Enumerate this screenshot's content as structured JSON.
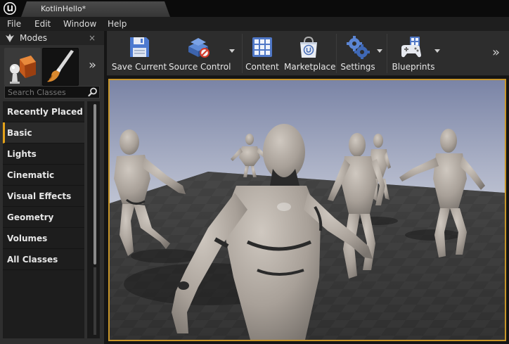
{
  "window": {
    "tab_title": "KotlinHello*",
    "logo_icon": "unreal-engine-logo-icon"
  },
  "menu": {
    "items": [
      "File",
      "Edit",
      "Window",
      "Help"
    ]
  },
  "modes": {
    "title": "Modes",
    "close_glyph": "×",
    "expand_glyph": "»",
    "tiles": [
      {
        "name": "place-mode",
        "icon": "place-actor-icon"
      },
      {
        "name": "paint-mode",
        "icon": "paint-brush-icon"
      }
    ],
    "search": {
      "placeholder": "Search Classes",
      "value": ""
    },
    "categories": [
      "Recently Placed",
      "Basic",
      "Lights",
      "Cinematic",
      "Visual Effects",
      "Geometry",
      "Volumes",
      "All Classes"
    ],
    "selected_category": "Basic"
  },
  "toolbar": {
    "expand_glyph": "»",
    "buttons": [
      {
        "label": "Save Current",
        "icon": "floppy-disk-icon",
        "dropdown": false
      },
      {
        "label": "Source Control",
        "icon": "source-control-icon",
        "dropdown": true
      },
      {
        "label": "Content",
        "icon": "content-browser-icon",
        "dropdown": false
      },
      {
        "label": "Marketplace",
        "icon": "marketplace-bag-icon",
        "dropdown": false
      },
      {
        "label": "Settings",
        "icon": "settings-gears-icon",
        "dropdown": true
      },
      {
        "label": "Blueprints",
        "icon": "gamepad-blueprint-icon",
        "dropdown": true
      }
    ]
  },
  "colors": {
    "accent": "#e3a21a",
    "viewport_border": "#c8962a",
    "panel": "#2f2f2f",
    "toolbar": "#2d2d2d"
  }
}
